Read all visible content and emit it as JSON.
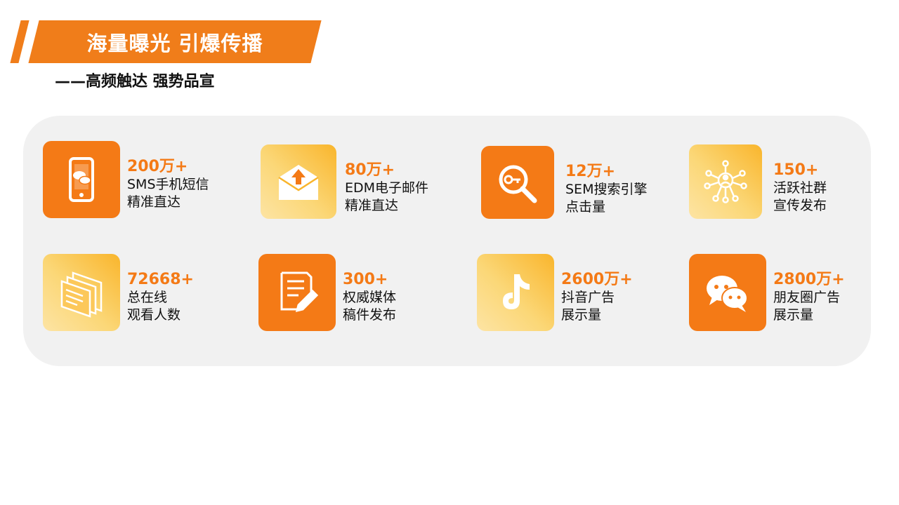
{
  "header": {
    "title": "海量曝光 引爆传播",
    "subtitle": "——高频触达 强势品宣"
  },
  "colors": {
    "accent": "#f47a16",
    "panel": "#f1f1f1",
    "gradient_start": "#f9b52c",
    "gradient_end": "#fde4a4"
  },
  "items": [
    {
      "value": "200万+",
      "line1": "SMS手机短信",
      "line2": "精准直达",
      "icon": "phone-chat-icon"
    },
    {
      "value": "80万+",
      "line1": "EDM电子邮件",
      "line2": "精准直达",
      "icon": "envelope-icon"
    },
    {
      "value": "12万+",
      "line1": "SEM搜索引擎",
      "line2": "点击量",
      "icon": "search-key-icon"
    },
    {
      "value": "150+",
      "line1": "活跃社群",
      "line2": "宣传发布",
      "icon": "community-network-icon"
    },
    {
      "value": "72668+",
      "line1": "总在线",
      "line2": "观看人数",
      "icon": "stacked-screens-icon"
    },
    {
      "value": "300+",
      "line1": "权威媒体",
      "line2": "稿件发布",
      "icon": "document-edit-icon"
    },
    {
      "value": "2600万+",
      "line1": "抖音广告",
      "line2": "展示量",
      "icon": "tiktok-icon"
    },
    {
      "value": "2800万+",
      "line1": "朋友圈广告",
      "line2": "展示量",
      "icon": "wechat-icon"
    }
  ]
}
